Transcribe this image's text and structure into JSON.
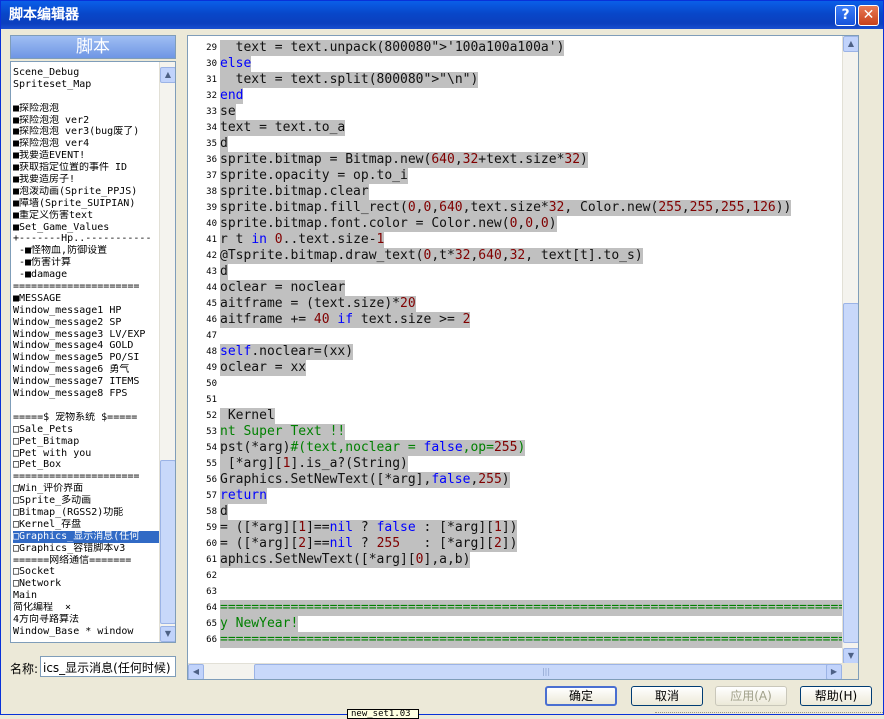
{
  "window": {
    "title": "脚本编辑器",
    "help_glyph": "?",
    "close_glyph": "✕"
  },
  "sidebar": {
    "header": "脚本",
    "items": [
      "Scene_Debug",
      "Spriteset_Map",
      "",
      "■探险泡泡",
      "■探险泡泡 ver2",
      "■探险泡泡 ver3(bug废了)",
      "■探险泡泡 ver4",
      "■我要造EVENT!",
      "■获取指定位置的事件 ID",
      "■我要造房子!",
      "■泡泼动画(Sprite_PPJS)",
      "■障墙(Sprite_SUIPIAN)",
      "■重定义伤害text",
      "■Set_Game_Values",
      "+-------Hp..-----------",
      " -■怪物血,防御设置",
      " -■伤害计算",
      " -■damage",
      "=====================",
      "■MESSAGE",
      "Window_message1 HP",
      "Window_message2 SP",
      "Window_message3 LV/EXP",
      "Window_message4 GOLD",
      "Window_message5 PO/SI",
      "Window_message6 勇气",
      "Window_message7 ITEMS",
      "Window_message8 FPS",
      "",
      "=====$ 宠物系统 $=====",
      "□Sale_Pets",
      "□Pet_Bitmap",
      "□Pet with you",
      "□Pet_Box",
      "=====================",
      "□Win_评价界面",
      "□Sprite_多动画",
      "□Bitmap_(RGSS2)功能",
      "□Kernel_存盘",
      "□Graphics_显示消息(任何",
      "□Graphics_容错脚本v3",
      "======网络通信=======",
      "□Socket",
      "□Network",
      "Main",
      "简化编程  ×",
      "4方向寻路算法",
      "Window_Base * window"
    ],
    "selected_index": 39,
    "scroll_up": "▲",
    "scroll_down": "▼"
  },
  "name_field": {
    "label": "名称:",
    "value": "ics_显示消息(任何时候)"
  },
  "editor": {
    "lines": [
      {
        "n": "29",
        "text": "  text = text.unpack('100a100a100a')",
        "hl": true
      },
      {
        "n": "30",
        "text": "else",
        "hl": true
      },
      {
        "n": "31",
        "text": "  text = text.split(\"\\n\")",
        "hl": true
      },
      {
        "n": "32",
        "text": "end",
        "hl": true
      },
      {
        "n": "33",
        "text": "se",
        "hl": true
      },
      {
        "n": "34",
        "text": "text = text.to_a",
        "hl": true
      },
      {
        "n": "35",
        "text": "d",
        "hl": true
      },
      {
        "n": "36",
        "text": "sprite.bitmap = Bitmap.new(640,32+text.size*32)",
        "hl": true
      },
      {
        "n": "37",
        "text": "sprite.opacity = op.to_i",
        "hl": true
      },
      {
        "n": "38",
        "text": "sprite.bitmap.clear",
        "hl": true
      },
      {
        "n": "39",
        "text": "sprite.bitmap.fill_rect(0,0,640,text.size*32, Color.new(255,255,255,126))",
        "hl": true
      },
      {
        "n": "40",
        "text": "sprite.bitmap.font.color = Color.new(0,0,0)",
        "hl": true
      },
      {
        "n": "41",
        "text": "r t in 0..text.size-1",
        "hl": true
      },
      {
        "n": "42",
        "text": "@Tsprite.bitmap.draw_text(0,t*32,640,32, text[t].to_s)",
        "hl": true
      },
      {
        "n": "43",
        "text": "d",
        "hl": true
      },
      {
        "n": "44",
        "text": "oclear = noclear",
        "hl": true
      },
      {
        "n": "45",
        "text": "aitframe = (text.size)*20",
        "hl": true
      },
      {
        "n": "46",
        "text": "aitframe += 40 if text.size >= 2",
        "hl": true
      },
      {
        "n": "47",
        "text": "",
        "hl": false
      },
      {
        "n": "48",
        "text": "self.noclear=(xx)",
        "hl": true
      },
      {
        "n": "49",
        "text": "oclear = xx",
        "hl": true
      },
      {
        "n": "50",
        "text": "",
        "hl": false
      },
      {
        "n": "51",
        "text": "",
        "hl": false
      },
      {
        "n": "52",
        "text": " Kernel",
        "hl": true
      },
      {
        "n": "53",
        "text": "nt Super Text !!",
        "hl": true
      },
      {
        "n": "54",
        "text": "pst(*arg)#(text,noclear = false,op=255)",
        "hl": true
      },
      {
        "n": "55",
        "text": " [*arg][1].is_a?(String)",
        "hl": true
      },
      {
        "n": "56",
        "text": "Graphics.SetNewText([*arg],false,255)",
        "hl": true
      },
      {
        "n": "57",
        "text": "return",
        "hl": true
      },
      {
        "n": "58",
        "text": "d",
        "hl": true
      },
      {
        "n": "59",
        "text": "= ([*arg][1]==nil ? false : [*arg][1])",
        "hl": true
      },
      {
        "n": "60",
        "text": "= ([*arg][2]==nil ? 255   : [*arg][2])",
        "hl": true
      },
      {
        "n": "61",
        "text": "aphics.SetNewText([*arg][0],a,b)",
        "hl": true
      },
      {
        "n": "62",
        "text": "",
        "hl": false
      },
      {
        "n": "63",
        "text": "",
        "hl": false
      },
      {
        "n": "64",
        "text": "=================================================================================",
        "hl": true
      },
      {
        "n": "65",
        "text": "y NewYear!",
        "hl": true
      },
      {
        "n": "66",
        "text": "=================================================================================",
        "hl": true
      }
    ],
    "scroll_up": "▲",
    "scroll_down": "▼",
    "scroll_left": "◀",
    "scroll_right": "▶",
    "hthumb_grip": "|||"
  },
  "buttons": {
    "ok": "确定",
    "cancel": "取消",
    "apply": "应用(A)",
    "help": "帮助(H)"
  },
  "tooltip": "new_set1.03",
  "colors": {
    "titlebar": "#0a5fe8",
    "selection": "#316ac5",
    "highlight": "#c0c0c0",
    "comment": "#008000"
  }
}
